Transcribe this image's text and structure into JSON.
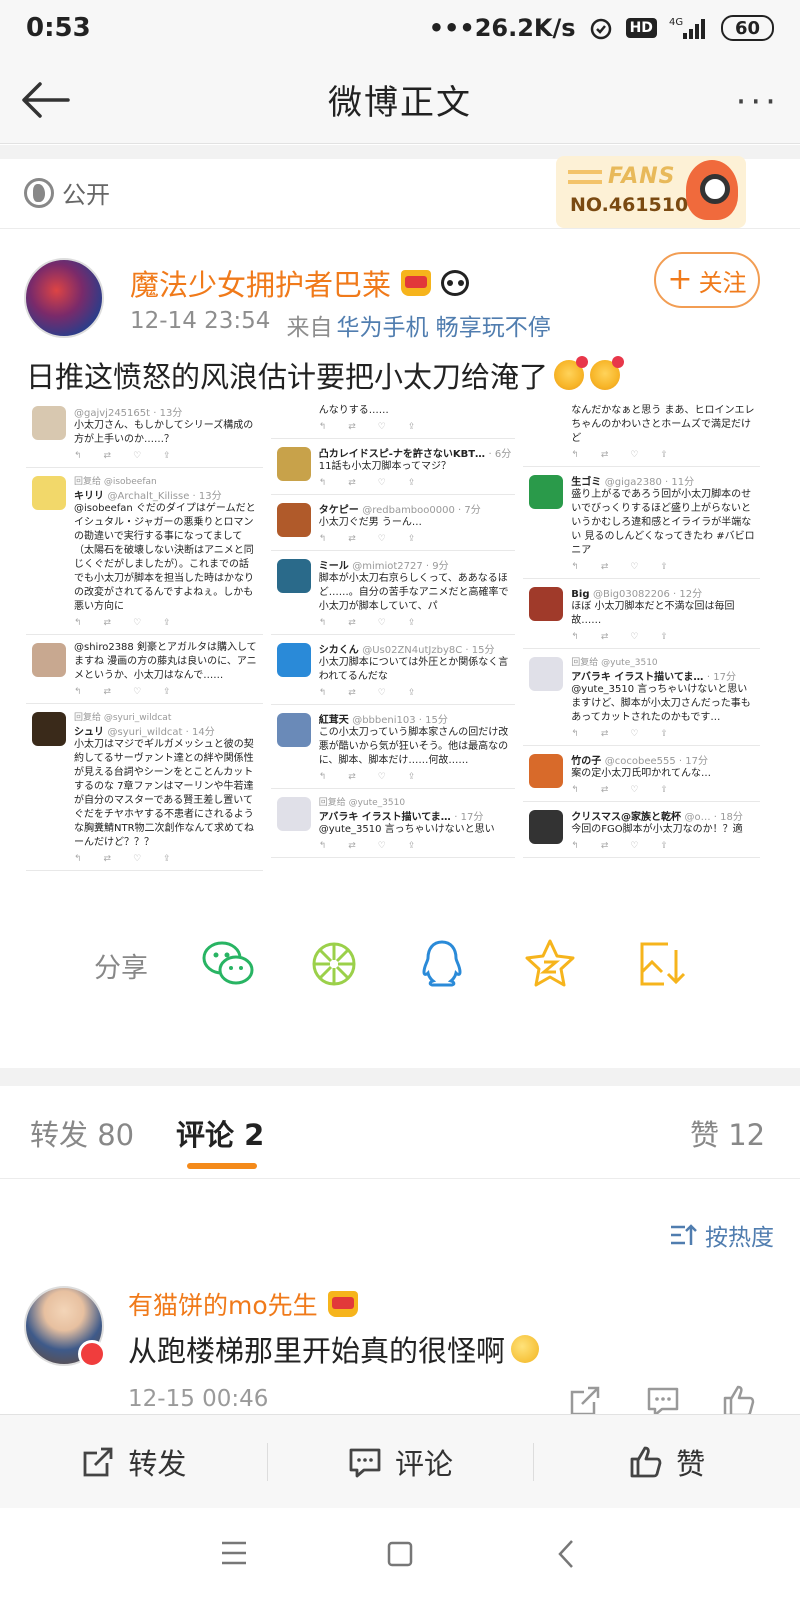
{
  "status_bar": {
    "time": "0:53",
    "net_speed": "26.2K/s",
    "hd": "HD",
    "signal": "4G",
    "battery": "60"
  },
  "nav": {
    "title": "微博正文",
    "more": "···"
  },
  "post": {
    "visibility": "公开",
    "fans_badge": {
      "label": "FANS",
      "number": "NO.4615107"
    },
    "author": "魔法少女拥护者巴莱",
    "time": "12-14 23:54",
    "source_prefix": "来自",
    "source": "华为手机 畅享玩不停",
    "follow_label": "关注",
    "text": "日推这愤怒的风浪估计要把小太刀给淹了",
    "share_label": "分享"
  },
  "screenshot_tweets": {
    "col1": [
      {
        "name": "",
        "handle": "@gajvj245165t · 13分",
        "reply": "",
        "body": "小太刀さん、もしかしてシリーズ構成の方が上手いのか……？",
        "color": "#d8c8b0"
      },
      {
        "name": "キリリ",
        "handle": "@Archalt_Kilisse · 13分",
        "reply": "回复给 @isobeefan",
        "body": "@isobeefan ぐだのダイプはゲームだとイシュタル・ジャガーの悪乗りとロマンの勘違いで実行する事になってまして（太陽石を破壊しない決断はアニメと同じくぐだがしましたが）。これまでの話でも小太刀が脚本を担当した時はかなりの改変がされてるんですよねぇ。しかも悪い方向に",
        "color": "#f2d86a"
      },
      {
        "name": "",
        "handle": "",
        "reply": "",
        "body": "@shiro2388 剣豪とアガルタは購入してますね 漫画の方の藤丸は良いのに、アニメというか、小太刀はなんで……",
        "color": "#c8a890"
      },
      {
        "name": "シュリ",
        "handle": "@syuri_wildcat · 14分",
        "reply": "回复给 @syuri_wildcat",
        "body": "小太刀はマジでギルガメッシュと彼の契約してるサーヴァント達との絆や関係性が見える台詞やシーンをとことんカットするのな 7章ファンはマーリンや牛若達が自分のマスターである賢王差し置いてぐだをチヤホヤする不患者にされるような胸糞鯖NTR物二次創作なんて求めてねーんだけど？？？",
        "color": "#3a2a1a"
      }
    ],
    "col2": [
      {
        "name": "",
        "handle": "",
        "reply": "",
        "body": "んなりする……",
        "color": ""
      },
      {
        "name": "凸カレイドスピ-ナを許さないKBT…",
        "handle": "· 6分",
        "reply": "",
        "body": "11話も小太刀脚本ってマジ？",
        "color": "#c8a24a"
      },
      {
        "name": "タケピー",
        "handle": "@redbamboo0000 · 7分",
        "reply": "",
        "body": "小太刀ぐだ男 うーん…",
        "color": "#b05a2a"
      },
      {
        "name": "ミール",
        "handle": "@mimiot2727 · 9分",
        "reply": "",
        "body": "脚本が小太刀右京らしくって、ああなるほど……。自分の苦手なアニメだと高確率で小太刀が脚本していて、パ",
        "color": "#2a6a8a"
      },
      {
        "name": "シカくん",
        "handle": "@Us02ZN4utJzby8C · 15分",
        "reply": "",
        "body": "小太刀脚本については外圧とか関係なく言われてるんだな",
        "color": "#2a8ad8"
      },
      {
        "name": "紅茸天",
        "handle": "@bbbeni103 · 15分",
        "reply": "",
        "body": "この小太刀っていう脚本家さんの回だけ改悪が酷いから気が狂いそう。他は最高なのに、脚本、脚本だけ……何故……",
        "color": "#6a8ab8"
      },
      {
        "name": "アバラキ イラスト描いてま…",
        "handle": "· 17分",
        "reply": "回复给 @yute_3510",
        "body": "@yute_3510 言っちゃいけないと思い",
        "color": "#e0e0e8"
      }
    ],
    "col3": [
      {
        "name": "",
        "handle": "",
        "reply": "",
        "body": "なんだかなぁと思う まあ、ヒロインエレちゃんのかわいさとホームズで満足だけど",
        "color": ""
      },
      {
        "name": "生ゴミ",
        "handle": "@giga2380 · 11分",
        "reply": "",
        "body": "盛り上がるであろう回が小太刀脚本のせいでびっくりするほど盛り上がらないというかむしろ違和感とイライラが半端ない 見るのしんどくなってきたわ #バビロニア",
        "color": "#2a9a4a"
      },
      {
        "name": "Big",
        "handle": "@Big03082206 · 12分",
        "reply": "",
        "body": "ほぼ 小太刀脚本だと不満な回は毎回故……",
        "color": "#a03a2a"
      },
      {
        "name": "アバラキ イラスト描いてま…",
        "handle": "· 17分",
        "reply": "回复给 @yute_3510",
        "body": "@yute_3510 言っちゃいけないと思いますけど、脚本が小太刀さんだった事もあってカットされたのかもです…",
        "color": "#e0e0e8"
      },
      {
        "name": "竹の子",
        "handle": "@cocobee555 · 17分",
        "reply": "",
        "body": "案の定小太刀氏叩かれてんな…",
        "color": "#d86a2a"
      },
      {
        "name": "クリスマス@家族と乾杯",
        "handle": "@o… · 18分",
        "reply": "",
        "body": "今回のFGO脚本が小太刀なのか！？適",
        "color": "#333"
      }
    ]
  },
  "tabs": [
    {
      "label": "转发",
      "count": "80"
    },
    {
      "label": "评论",
      "count": "2"
    },
    {
      "label": "赞",
      "count": "12"
    }
  ],
  "sort_label": "按热度",
  "comment": {
    "author": "有猫饼的mo先生",
    "text": "从跑楼梯那里开始真的很怪啊",
    "time": "12-15 00:46"
  },
  "bottom_bar": {
    "repost": "转发",
    "comment": "评论",
    "like": "赞"
  },
  "colors": {
    "accent": "#f07a1a",
    "link": "#507daf",
    "wechat": "#28b463",
    "qq": "#2a8ad8",
    "star": "#f6b41c"
  }
}
